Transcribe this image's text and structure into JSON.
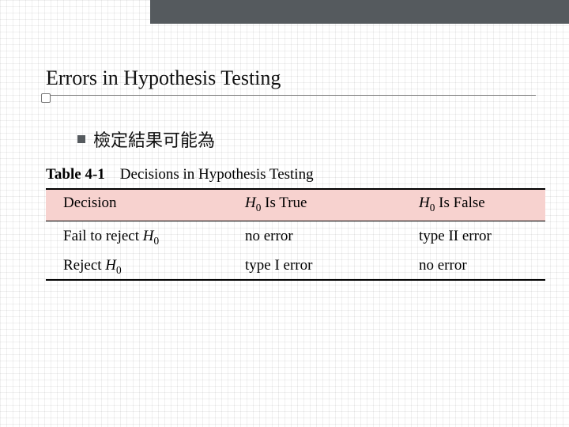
{
  "title": "Errors in Hypothesis Testing",
  "subtitle": "檢定結果可能為",
  "table": {
    "label": "Table 4-1",
    "caption": "Decisions in Hypothesis Testing",
    "header": {
      "decision": "Decision",
      "h0_true_prefix": "H",
      "h0_true_sub": "0",
      "h0_true_suffix": " Is True",
      "h0_false_prefix": "H",
      "h0_false_sub": "0",
      "h0_false_suffix": " Is False"
    },
    "rows": [
      {
        "d_prefix": "Fail to reject ",
        "d_sym": "H",
        "d_sub": "0",
        "c2": "no error",
        "c3": "type II error"
      },
      {
        "d_prefix": "Reject ",
        "d_sym": "H",
        "d_sub": "0",
        "c2": "type I error",
        "c3": "no error"
      }
    ]
  }
}
